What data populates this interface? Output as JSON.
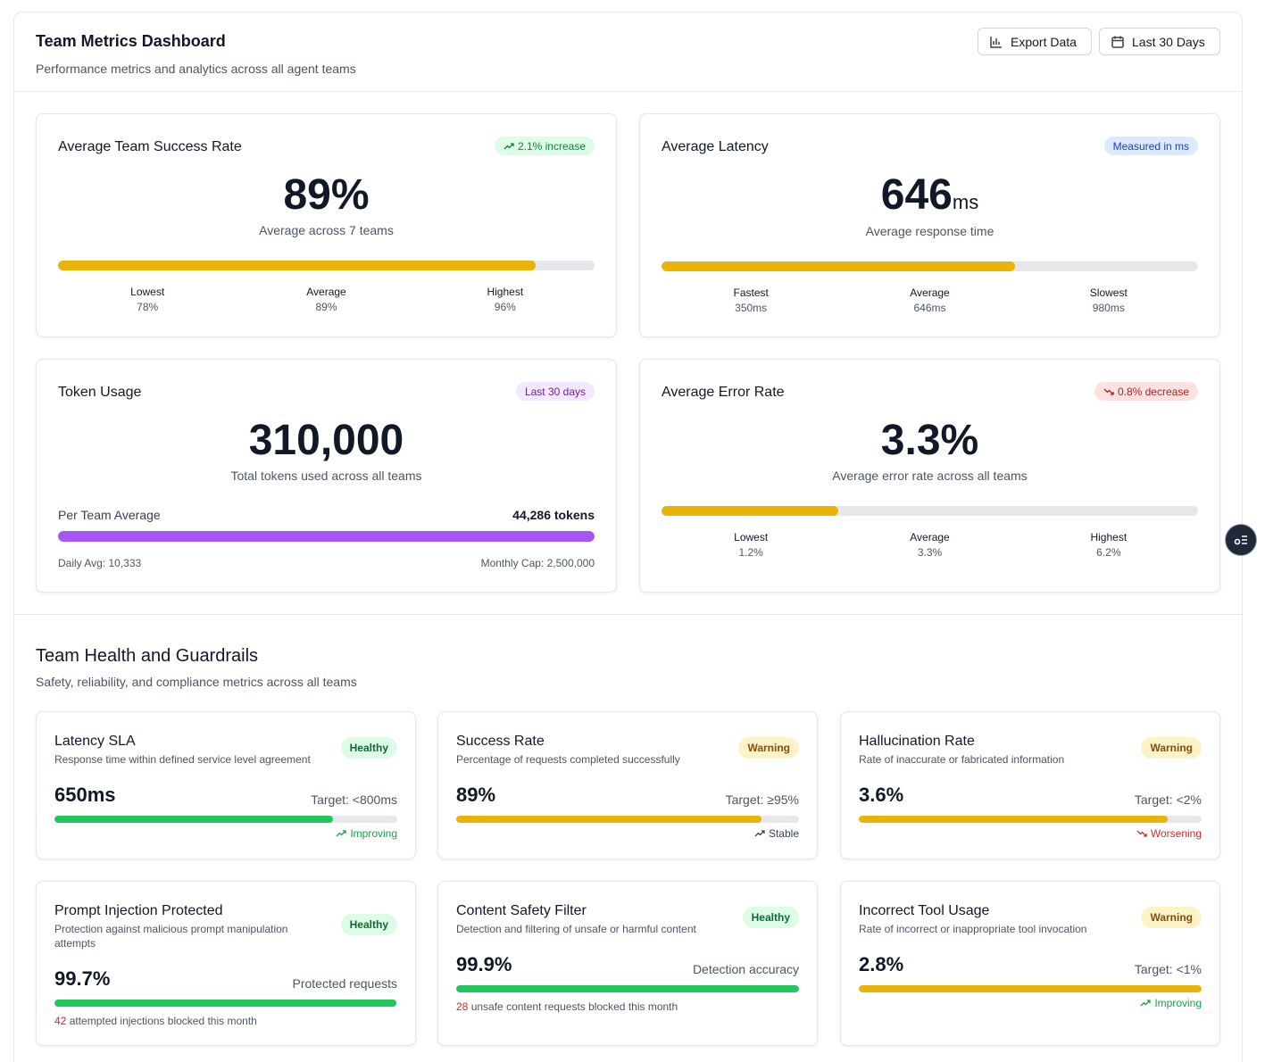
{
  "header": {
    "title": "Team Metrics Dashboard",
    "subtitle": "Performance metrics and analytics across all agent teams",
    "export_label": "Export Data",
    "range_label": "Last 30 Days"
  },
  "metrics": {
    "success": {
      "title": "Average Team Success Rate",
      "badge": "2.1% increase",
      "value": "89%",
      "caption": "Average across 7 teams",
      "fill_fraction": 0.89,
      "stats": [
        {
          "label": "Lowest",
          "value": "78%"
        },
        {
          "label": "Average",
          "value": "89%"
        },
        {
          "label": "Highest",
          "value": "96%"
        }
      ]
    },
    "latency": {
      "title": "Average Latency",
      "badge": "Measured in ms",
      "value": "646",
      "unit": "ms",
      "caption": "Average response time",
      "fill_fraction": 0.659,
      "stats": [
        {
          "label": "Fastest",
          "value": "350ms"
        },
        {
          "label": "Average",
          "value": "646ms"
        },
        {
          "label": "Slowest",
          "value": "980ms"
        }
      ]
    },
    "tokens": {
      "title": "Token Usage",
      "badge": "Last 30 days",
      "value": "310,000",
      "caption": "Total tokens used across all teams",
      "per_team_label": "Per Team Average",
      "per_team_value": "44,286 tokens",
      "fill_fraction": 1.0,
      "daily": "Daily Avg: 10,333",
      "cap": "Monthly Cap: 2,500,000"
    },
    "error": {
      "title": "Average Error Rate",
      "badge": "0.8% decrease",
      "value": "3.3%",
      "caption": "Average error rate across all teams",
      "fill_fraction": 0.33,
      "stats": [
        {
          "label": "Lowest",
          "value": "1.2%"
        },
        {
          "label": "Average",
          "value": "3.3%"
        },
        {
          "label": "Highest",
          "value": "6.2%"
        }
      ]
    }
  },
  "health": {
    "title": "Team Health and Guardrails",
    "subtitle": "Safety, reliability, and compliance metrics across all teams",
    "cards": [
      {
        "title": "Latency SLA",
        "desc": "Response time within defined service level agreement",
        "status": "Healthy",
        "value": "650ms",
        "target": "Target: <800ms",
        "fill_fraction": 0.8125,
        "trend": "Improving"
      },
      {
        "title": "Success Rate",
        "desc": "Percentage of requests completed successfully",
        "status": "Warning",
        "value": "89%",
        "target": "Target: ≥95%",
        "fill_fraction": 0.89,
        "trend": "Stable"
      },
      {
        "title": "Hallucination Rate",
        "desc": "Rate of inaccurate or fabricated information",
        "status": "Warning",
        "value": "3.6%",
        "target": "Target: <2%",
        "fill_fraction": 0.9,
        "trend": "Worsening"
      },
      {
        "title": "Prompt Injection Protected",
        "desc": "Protection against malicious prompt manipulation attempts",
        "status": "Healthy",
        "value": "99.7%",
        "target": "Protected requests",
        "fill_fraction": 0.997,
        "note_num": "42",
        "note_text": "attempted injections blocked this month"
      },
      {
        "title": "Content Safety Filter",
        "desc": "Detection and filtering of unsafe or harmful content",
        "status": "Healthy",
        "value": "99.9%",
        "target": "Detection accuracy",
        "fill_fraction": 0.999,
        "note_num": "28",
        "note_text": "unsafe content requests blocked this month"
      },
      {
        "title": "Incorrect Tool Usage",
        "desc": "Rate of incorrect or inappropriate tool invocation",
        "status": "Warning",
        "value": "2.8%",
        "target": "Target: <1%",
        "fill_fraction": 1.0,
        "trend": "Improving"
      }
    ]
  },
  "colors": {
    "yellow": "#eab308",
    "green": "#22c55e",
    "purple": "#a855f7",
    "trend_good": "#16a34a",
    "trend_bad": "#dc2626",
    "trend_neutral": "#374151"
  }
}
